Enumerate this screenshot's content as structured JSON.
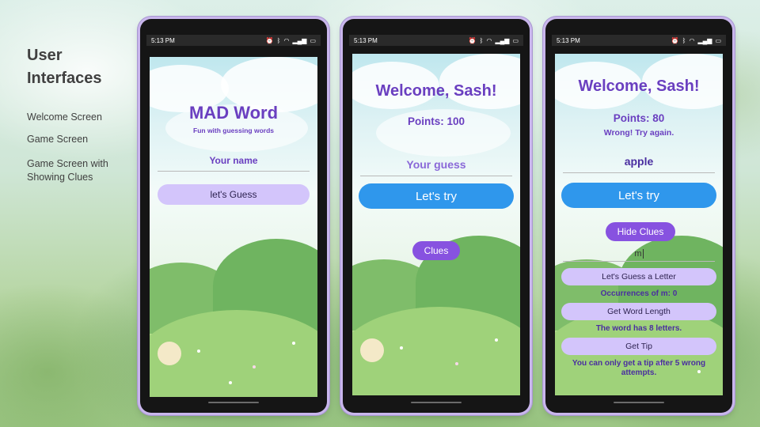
{
  "slide": {
    "heading": "User\nInterfaces",
    "nav": [
      "Welcome Screen",
      "Game Screen",
      "Game Screen with Showing Clues"
    ]
  },
  "status_bar": {
    "time": "5:13 PM",
    "icons": [
      "alarm-icon",
      "bluetooth-icon",
      "wifi-icon",
      "signal-icon",
      "battery-icon"
    ]
  },
  "welcome_screen": {
    "title": "MAD Word",
    "subtitle": "Fun with guessing words",
    "name_placeholder": "Your name",
    "button": "let's Guess"
  },
  "game_screen": {
    "greeting": "Welcome, Sash!",
    "points": "Points: 100",
    "guess_placeholder": "Your guess",
    "try_button": "Let's try",
    "clues_button": "Clues"
  },
  "clues_screen": {
    "greeting": "Welcome, Sash!",
    "points": "Points: 80",
    "feedback": "Wrong! Try again.",
    "guess_value": "apple",
    "try_button": "Let's try",
    "hide_clues_button": "Hide Clues",
    "letter_value": "m",
    "guess_letter_button": "Let's Guess a Letter",
    "occurrences": "Occurrences of m: 0",
    "word_length_button": "Get Word Length",
    "word_length_result": "The word has 8 letters.",
    "tip_button": "Get Tip",
    "tip_result": "You can only get a tip after 5 wrong attempts."
  },
  "colors": {
    "title_purple": "#6a3fc0",
    "button_blue": "#2f97ec",
    "button_lavender": "#d3c5fb",
    "button_violet": "#8752e0"
  }
}
